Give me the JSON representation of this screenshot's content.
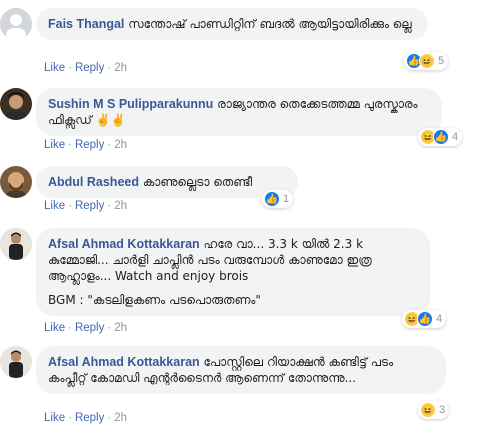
{
  "comments": [
    {
      "author": "Fais Thangal",
      "text": " സന്തോഷ് പാണ്ഡിറ്റിന് ബദൽ ആയിട്ടായിരിക്കും ല്ലെ",
      "like": "Like",
      "reply": "Reply",
      "time": "2h",
      "reaction_count": "5",
      "reactions": [
        "like-icon",
        "haha-icon"
      ]
    },
    {
      "author": "Sushin M S Pulipparakunnu",
      "text": " രാജ്യാന്തര തെക്കേടത്തമ്മ പുരസ്കാരം ഫിക്സഡ് ✌️✌️",
      "like": "Like",
      "reply": "Reply",
      "time": "2h",
      "reaction_count": "4",
      "reactions": [
        "haha-icon",
        "like-icon"
      ]
    },
    {
      "author": "Abdul Rasheed",
      "text": " കാണുല്ലെടാ തെണ്ടീ",
      "like": "Like",
      "reply": "Reply",
      "time": "2h",
      "reaction_count": "1",
      "reactions": [
        "like-icon"
      ]
    },
    {
      "author": "Afsal Ahmad Kottakkaran",
      "text": " ഹരേ വാ... 3.3 k യിൽ 2.3 k കുമ്മോജി... ചാർളി ചാപ്ലിൻ പടം വരുമ്പോൾ കാണുമോ ഇത്ര ആഹ്ലാളം... Watch and enjoy brois",
      "text2": "BGM : \"കടലിളകണം പടപൊരുതണം\"",
      "like": "Like",
      "reply": "Reply",
      "time": "2h",
      "reaction_count": "4",
      "reactions": [
        "haha-icon",
        "like-icon"
      ]
    },
    {
      "author": "Afsal Ahmad Kottakkaran",
      "text": " പോസ്റ്റിലെ റിയാക്ഷൻ കണ്ടിട്ട് പടം കംപ്ലീറ്റ് കോമഡി എന്റർടൈനർ ആണെന്ന് തോന്നുന്നു...",
      "like": "Like",
      "reply": "Reply",
      "time": "2h",
      "reaction_count": "3",
      "reactions": [
        "haha-icon"
      ]
    }
  ]
}
